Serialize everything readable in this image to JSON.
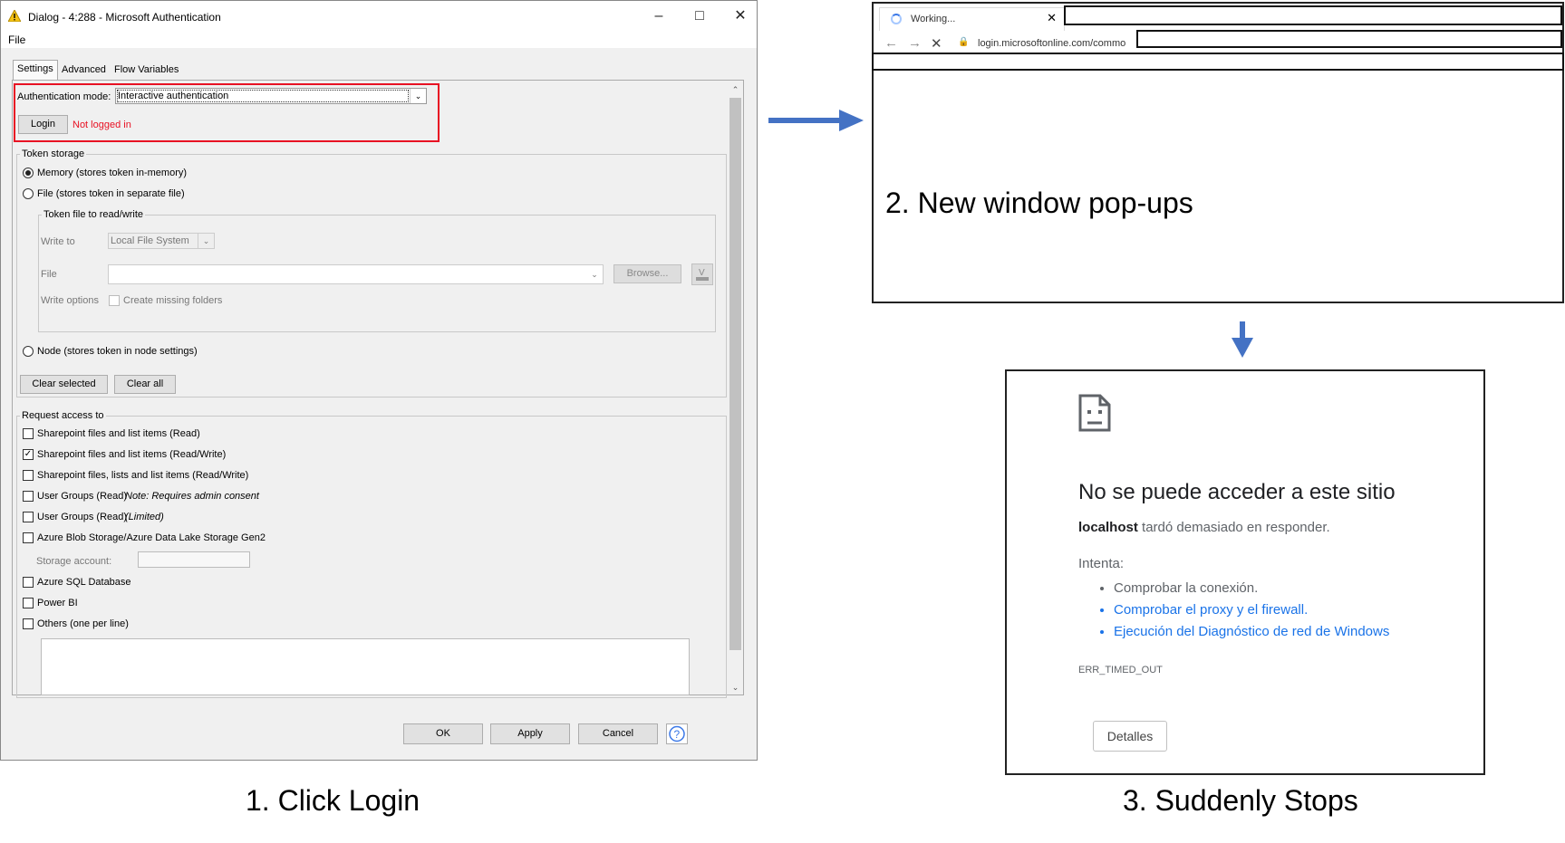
{
  "dialog": {
    "title": "Dialog - 4:288 - Microsoft Authentication",
    "menu": [
      "File"
    ],
    "tabs": [
      "Settings",
      "Advanced",
      "Flow Variables"
    ],
    "auth_mode_label": "Authentication mode:",
    "auth_mode_value": "Interactive authentication",
    "login_button": "Login",
    "login_status": "Not logged in",
    "token_storage": {
      "title": "Token storage",
      "memory": "Memory (stores token in-memory)",
      "file": "File (stores token in separate file)",
      "token_file_group": "Token file to read/write",
      "write_to_label": "Write to",
      "write_to_value": "Local File System",
      "file_label": "File",
      "browse_button": "Browse...",
      "write_options_label": "Write options",
      "create_missing_folders": "Create missing folders",
      "node": "Node (stores token in node settings)",
      "clear_selected": "Clear selected",
      "clear_all": "Clear all"
    },
    "request_access": {
      "title": "Request access to",
      "items": [
        "Sharepoint files and list items (Read)",
        "Sharepoint files and list items (Read/Write)",
        "Sharepoint files, lists and list items (Read/Write)",
        "User Groups (Read)",
        "User Groups (Read)",
        "Azure Blob Storage/Azure Data Lake Storage Gen2"
      ],
      "note_admin": "Note: Requires admin consent",
      "note_limited": "(Limited)",
      "storage_account_label": "Storage account:",
      "items2": [
        "Azure SQL Database",
        "Power BI",
        "Others (one per line)"
      ]
    },
    "buttons": {
      "ok": "OK",
      "apply": "Apply",
      "cancel": "Cancel",
      "help": "?"
    }
  },
  "browser": {
    "tab_title": "Working...",
    "url": "login.microsoftonline.com/commo"
  },
  "error_page": {
    "title": "No se puede acceder a este sitio",
    "host": "localhost",
    "message": "tardó demasiado en responder.",
    "try_label": "Intenta:",
    "suggestions": [
      "Comprobar la conexión.",
      "Comprobar el proxy y el firewall.",
      "Ejecución del Diagnóstico de red de Windows"
    ],
    "error_code": "ERR_TIMED_OUT",
    "details_button": "Detalles"
  },
  "captions": {
    "step1": "1. Click Login",
    "step2": "2. New window pop-ups",
    "step3": "3. Suddenly Stops"
  },
  "colors": {
    "highlight": "#e81123",
    "arrow": "#4472c4",
    "link": "#1a73e8"
  }
}
